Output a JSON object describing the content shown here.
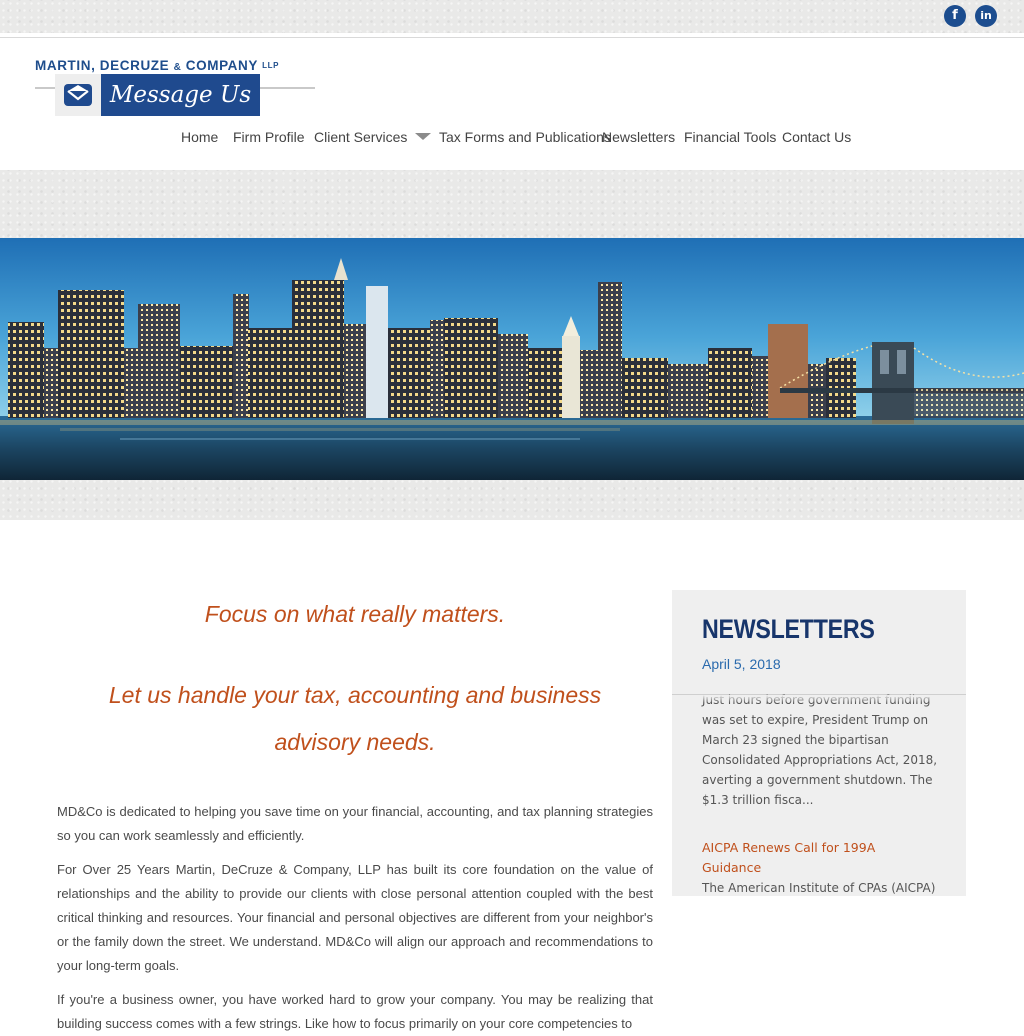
{
  "header": {
    "firm_name_part1": "MARTIN, DECRUZE ",
    "firm_amp": "&",
    "firm_name_part2": " COMPANY",
    "firm_suffix": "LLP",
    "message_label": "Message Us"
  },
  "social": {
    "facebook_glyph": "f",
    "linkedin_glyph": "in"
  },
  "nav": {
    "items": [
      "Home",
      "Firm Profile",
      "Client Services",
      "Tax Forms and Publications",
      "Newsletters",
      "Financial Tools",
      "Contact Us"
    ]
  },
  "main": {
    "tagline_1": "Focus on what really matters.",
    "tagline_2_line1": "Let us handle your tax, accounting and business",
    "tagline_2_line2": "advisory needs.",
    "paragraphs": [
      "MD&Co is dedicated to helping you save time on your financial, accounting, and tax planning strategies so you can work seamlessly and efficiently.",
      "For Over 25 Years Martin, DeCruze & Company, LLP has built its core foundation on the value of relationships and the ability to provide our clients with close personal attention coupled with the best critical thinking and resources. Your financial and personal objectives are different from your neighbor's or the family down the street. We understand. MD&Co will align our approach and recommendations to your long-term goals.",
      "If you're a business owner, you have worked hard to grow your company.  You may be realizing that building success comes with a few strings. Like how to focus primarily on your core competencies to"
    ]
  },
  "sidebar": {
    "title": "NEWSLETTERS",
    "date": "April 5, 2018",
    "item1_excerpt": "Just hours before government funding was set to expire, President Trump on March 23 signed the bipartisan Consolidated Appropriations Act, 2018, averting a government shutdown. The $1.3 trillion fisca...",
    "item2_title": "AICPA Renews Call for 199A Guidance",
    "item2_excerpt": "The American Institute of CPAs (AICPA) has renewed its call for immediate"
  },
  "colors": {
    "brand_blue": "#1f4a8e",
    "accent_orange": "#c0501c",
    "sidebar_bg": "#efefef"
  }
}
